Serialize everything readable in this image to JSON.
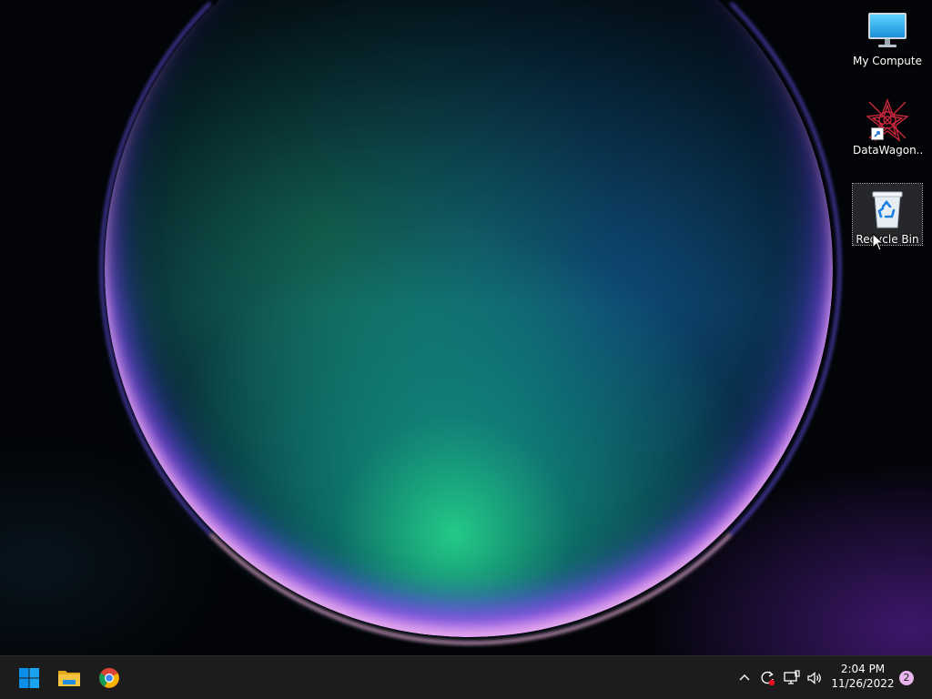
{
  "desktop": {
    "icons": [
      {
        "label": "My Computer",
        "icon": "monitor-icon"
      },
      {
        "label": "DataWagon...",
        "icon": "datawagon-logo-icon"
      },
      {
        "label": "Recycle Bin",
        "icon": "recycle-bin-icon",
        "selected": true
      }
    ]
  },
  "taskbar": {
    "pinned": [
      {
        "name": "Start",
        "icon": "windows-logo-icon"
      },
      {
        "name": "File Explorer",
        "icon": "folder-icon"
      },
      {
        "name": "Google Chrome",
        "icon": "chrome-icon"
      }
    ],
    "tray": {
      "icons": [
        "chevron-up-icon",
        "sync-icon",
        "network-icon",
        "volume-icon"
      ],
      "clock": {
        "time": "2:04 PM",
        "date": "11/26/2022"
      },
      "notification_count": "2"
    }
  },
  "colors": {
    "taskbar_bg": "#1c1c1c",
    "windows_blue": "#0a8ee8",
    "folder_yellow": "#f5c542",
    "notification_badge": "#e8b4ee"
  }
}
